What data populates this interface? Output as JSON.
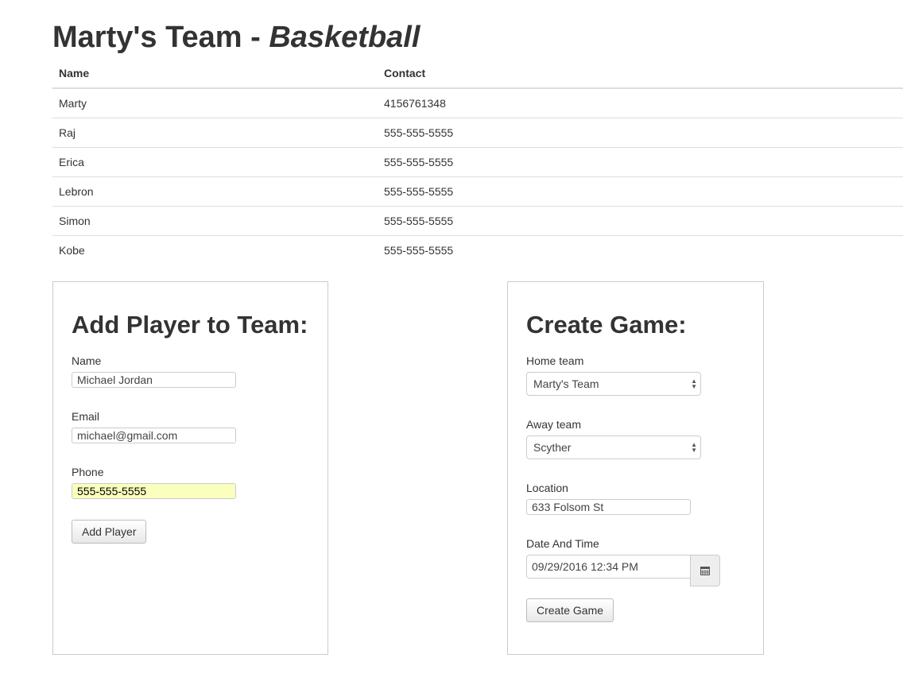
{
  "title": {
    "team": "Marty's Team - ",
    "sport": "Basketball"
  },
  "roster": {
    "columns": [
      "Name",
      "Contact"
    ],
    "rows": [
      [
        "Marty",
        "4156761348"
      ],
      [
        "Raj",
        "555-555-5555"
      ],
      [
        "Erica",
        "555-555-5555"
      ],
      [
        "Lebron",
        "555-555-5555"
      ],
      [
        "Simon",
        "555-555-5555"
      ],
      [
        "Kobe",
        "555-555-5555"
      ]
    ]
  },
  "add_player": {
    "heading": "Add Player to Team:",
    "name_label": "Name",
    "name_value": "Michael Jordan",
    "email_label": "Email",
    "email_value": "michael@gmail.com",
    "phone_label": "Phone",
    "phone_value": "555-555-5555",
    "submit": "Add Player",
    "autofill_color": "#faffbd"
  },
  "create_game": {
    "heading": "Create Game:",
    "home_label": "Home team",
    "home_value": "Marty's Team",
    "away_label": "Away team",
    "away_value": "Scyther",
    "location_label": "Location",
    "location_value": "633 Folsom St",
    "datetime_label": "Date And Time",
    "datetime_value": "09/29/2016 12:34 PM",
    "calendar_icon": "calendar-icon",
    "submit": "Create Game"
  }
}
